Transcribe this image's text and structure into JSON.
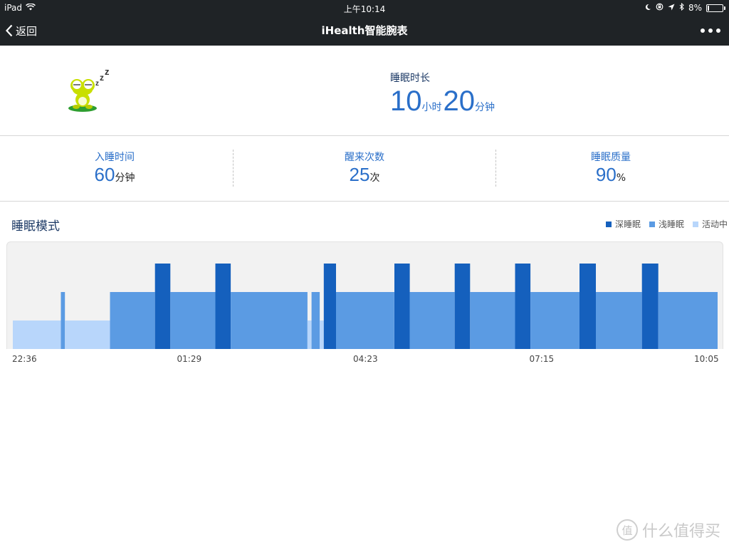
{
  "statusbar": {
    "device": "iPad",
    "time": "上午10:14",
    "battery": "8%",
    "battery_level": 0.08
  },
  "navbar": {
    "back_label": "返回",
    "title": "iHealth智能腕表"
  },
  "summary": {
    "duration_label": "睡眠时长",
    "hours": "10",
    "hours_unit": "小时",
    "minutes": "20",
    "minutes_unit": "分钟"
  },
  "stats": [
    {
      "label": "入睡时间",
      "value": "60",
      "unit": "分钟"
    },
    {
      "label": "醒来次数",
      "value": "25",
      "unit": "次"
    },
    {
      "label": "睡眠质量",
      "value": "90",
      "unit": "%"
    }
  ],
  "pattern": {
    "title": "睡眠模式",
    "legend": [
      {
        "name": "深睡眠",
        "color": "#1560bd"
      },
      {
        "name": "浅睡眠",
        "color": "#5b9be3"
      },
      {
        "name": "活动中",
        "color": "#b8d6fb"
      }
    ]
  },
  "chart_data": {
    "type": "bar",
    "title": "睡眠模式",
    "x_range": [
      "22:36",
      "10:05"
    ],
    "tick_labels": [
      "22:36",
      "01:29",
      "04:23",
      "07:15",
      "10:05"
    ],
    "levels": {
      "活动中": 1,
      "浅睡眠": 2,
      "深睡眠": 3
    },
    "segments": [
      {
        "start": "22:36",
        "end": "23:23",
        "state": "活动中"
      },
      {
        "start": "23:23",
        "end": "23:27",
        "state": "浅睡眠"
      },
      {
        "start": "23:27",
        "end": "00:11",
        "state": "活动中"
      },
      {
        "start": "00:11",
        "end": "00:55",
        "state": "浅睡眠"
      },
      {
        "start": "00:55",
        "end": "01:10",
        "state": "深睡眠"
      },
      {
        "start": "01:10",
        "end": "01:54",
        "state": "浅睡眠"
      },
      {
        "start": "01:54",
        "end": "02:09",
        "state": "深睡眠"
      },
      {
        "start": "02:09",
        "end": "03:24",
        "state": "浅睡眠"
      },
      {
        "start": "03:24",
        "end": "03:28",
        "state": "活动中"
      },
      {
        "start": "03:28",
        "end": "03:36",
        "state": "浅睡眠"
      },
      {
        "start": "03:36",
        "end": "03:40",
        "state": "活动中"
      },
      {
        "start": "03:40",
        "end": "03:52",
        "state": "深睡眠"
      },
      {
        "start": "03:52",
        "end": "04:49",
        "state": "浅睡眠"
      },
      {
        "start": "04:49",
        "end": "05:04",
        "state": "深睡眠"
      },
      {
        "start": "05:04",
        "end": "05:48",
        "state": "浅睡眠"
      },
      {
        "start": "05:48",
        "end": "06:03",
        "state": "深睡眠"
      },
      {
        "start": "06:03",
        "end": "06:47",
        "state": "浅睡眠"
      },
      {
        "start": "06:47",
        "end": "07:02",
        "state": "深睡眠"
      },
      {
        "start": "07:02",
        "end": "07:50",
        "state": "浅睡眠"
      },
      {
        "start": "07:50",
        "end": "08:06",
        "state": "深睡眠"
      },
      {
        "start": "08:06",
        "end": "08:51",
        "state": "浅睡眠"
      },
      {
        "start": "08:51",
        "end": "09:07",
        "state": "深睡眠"
      },
      {
        "start": "09:07",
        "end": "10:05",
        "state": "浅睡眠"
      }
    ]
  },
  "watermark": {
    "mark": "值",
    "text": "什么值得买"
  }
}
